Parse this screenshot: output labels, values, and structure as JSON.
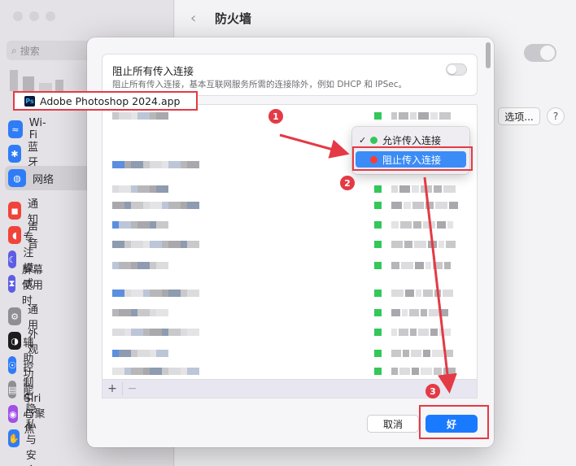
{
  "window": {
    "page_title": "防火墙"
  },
  "sidebar": {
    "search_placeholder": "搜索",
    "items": [
      {
        "label": "Wi-Fi",
        "icon": "wifi-icon",
        "color": "#2f7cf6",
        "glyph": "≈"
      },
      {
        "label": "蓝牙",
        "icon": "bluetooth-icon",
        "color": "#2f7cf6",
        "glyph": "✱"
      },
      {
        "label": "网络",
        "icon": "network-globe-icon",
        "color": "#2f7cf6",
        "glyph": "◍"
      },
      {
        "label": "通知",
        "icon": "notification-icon",
        "color": "#f0443a",
        "glyph": "◼"
      },
      {
        "label": "声音",
        "icon": "sound-icon",
        "color": "#f0443a",
        "glyph": "◖"
      },
      {
        "label": "专注模式",
        "icon": "focus-moon-icon",
        "color": "#5d5ce6",
        "glyph": "☾"
      },
      {
        "label": "屏幕使用时",
        "icon": "screen-time-icon",
        "color": "#5d5ce6",
        "glyph": "⧗"
      },
      {
        "label": "通用",
        "icon": "general-gear-icon",
        "color": "#8e8e93",
        "glyph": "⚙"
      },
      {
        "label": "外观",
        "icon": "appearance-icon",
        "color": "#1c1c1e",
        "glyph": "◑"
      },
      {
        "label": "辅助功能",
        "icon": "accessibility-icon",
        "color": "#2f7cf6",
        "glyph": "☉"
      },
      {
        "label": "控制中心",
        "icon": "control-center-icon",
        "color": "#8e8e93",
        "glyph": "▤"
      },
      {
        "label": "Siri与聚焦",
        "icon": "siri-icon",
        "color": "#a14fe6",
        "glyph": "◉"
      },
      {
        "label": "隐私与安全",
        "icon": "privacy-hand-icon",
        "color": "#2f7cf6",
        "glyph": "✋"
      }
    ],
    "active_label": "网络"
  },
  "main": {
    "options_label": "选项...",
    "help_label": "?"
  },
  "sheet": {
    "block_title": "阻止所有传入连接",
    "block_desc": "阻止所有传入连接，基本互联网服务所需的连接除外，例如 DHCP 和 IPSec。",
    "block_toggle_on": false,
    "app_name": "Adobe Photoshop 2024.app",
    "app_icon_text": "Ps",
    "menu": {
      "allow_label": "允许传入连接",
      "block_label": "阻止传入连接",
      "allow_color": "#34c759",
      "block_color": "#ff3b30"
    },
    "list_add": "+",
    "list_remove": "−",
    "cancel_label": "取消",
    "ok_label": "好"
  },
  "annotations": {
    "badge_1": "1",
    "badge_2": "2",
    "badge_3": "3",
    "accent": "#e43a45"
  }
}
